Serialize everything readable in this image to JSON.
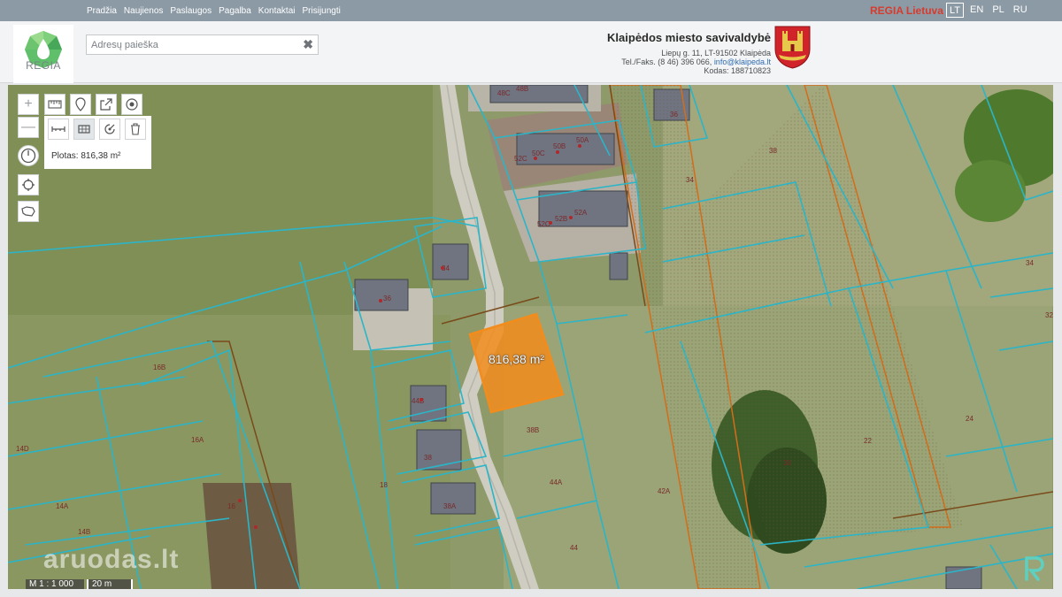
{
  "nav": {
    "items": [
      "Pradžia",
      "Naujienos",
      "Paslaugos",
      "Pagalba",
      "Kontaktai",
      "Prisijungti"
    ],
    "brand": "REGIA Lietuva",
    "languages": [
      "LT",
      "EN",
      "PL",
      "RU"
    ],
    "active_language": "LT"
  },
  "header": {
    "logo_text": "REGIA",
    "search": {
      "placeholder": "Adresų paieška",
      "value": ""
    },
    "municipality": {
      "name": "Klaipėdos miesto savivaldybė",
      "address": "Liepų g. 11, LT-91502 Klaipėda",
      "phone_prefix": "Tel./Faks. (8 46) 396 066,",
      "email": "info@klaipeda.lt",
      "code": "Kodas: 188710823"
    }
  },
  "map": {
    "measure": {
      "result_label": "Plotas: 816,38 m²",
      "overlay_area": "816,38 m²"
    },
    "scale": {
      "ratio": "M 1 : 1 000",
      "length": "20 m"
    },
    "watermark": "aruodas.lt",
    "parcel_numbers": [
      "48C",
      "48B",
      "36",
      "38",
      "52C",
      "50C",
      "50B",
      "50A",
      "52C",
      "52B",
      "52A",
      "34",
      "34",
      "36",
      "34",
      "32",
      "16B",
      "44B",
      "16A",
      "14D",
      "14A",
      "14B",
      "16",
      "18",
      "38",
      "38A",
      "38B",
      "44A",
      "44",
      "42A",
      "30",
      "22",
      "24",
      "26"
    ]
  },
  "colors": {
    "topbar": "#8c9aa5",
    "brand_red": "#d63b2e",
    "parcel_cyan": "#2bb5c8",
    "highlight_orange": "#f28c1c"
  },
  "icons": {
    "zoom_in": "plus-icon",
    "zoom_out": "minus-icon",
    "compass": "compass-icon",
    "locate": "crosshair-icon",
    "layers": "region-outline-icon",
    "measure_length": "ruler-icon",
    "place_marker": "pin-icon",
    "export": "export-icon",
    "draw_point": "target-icon",
    "clear": "trash-icon"
  }
}
